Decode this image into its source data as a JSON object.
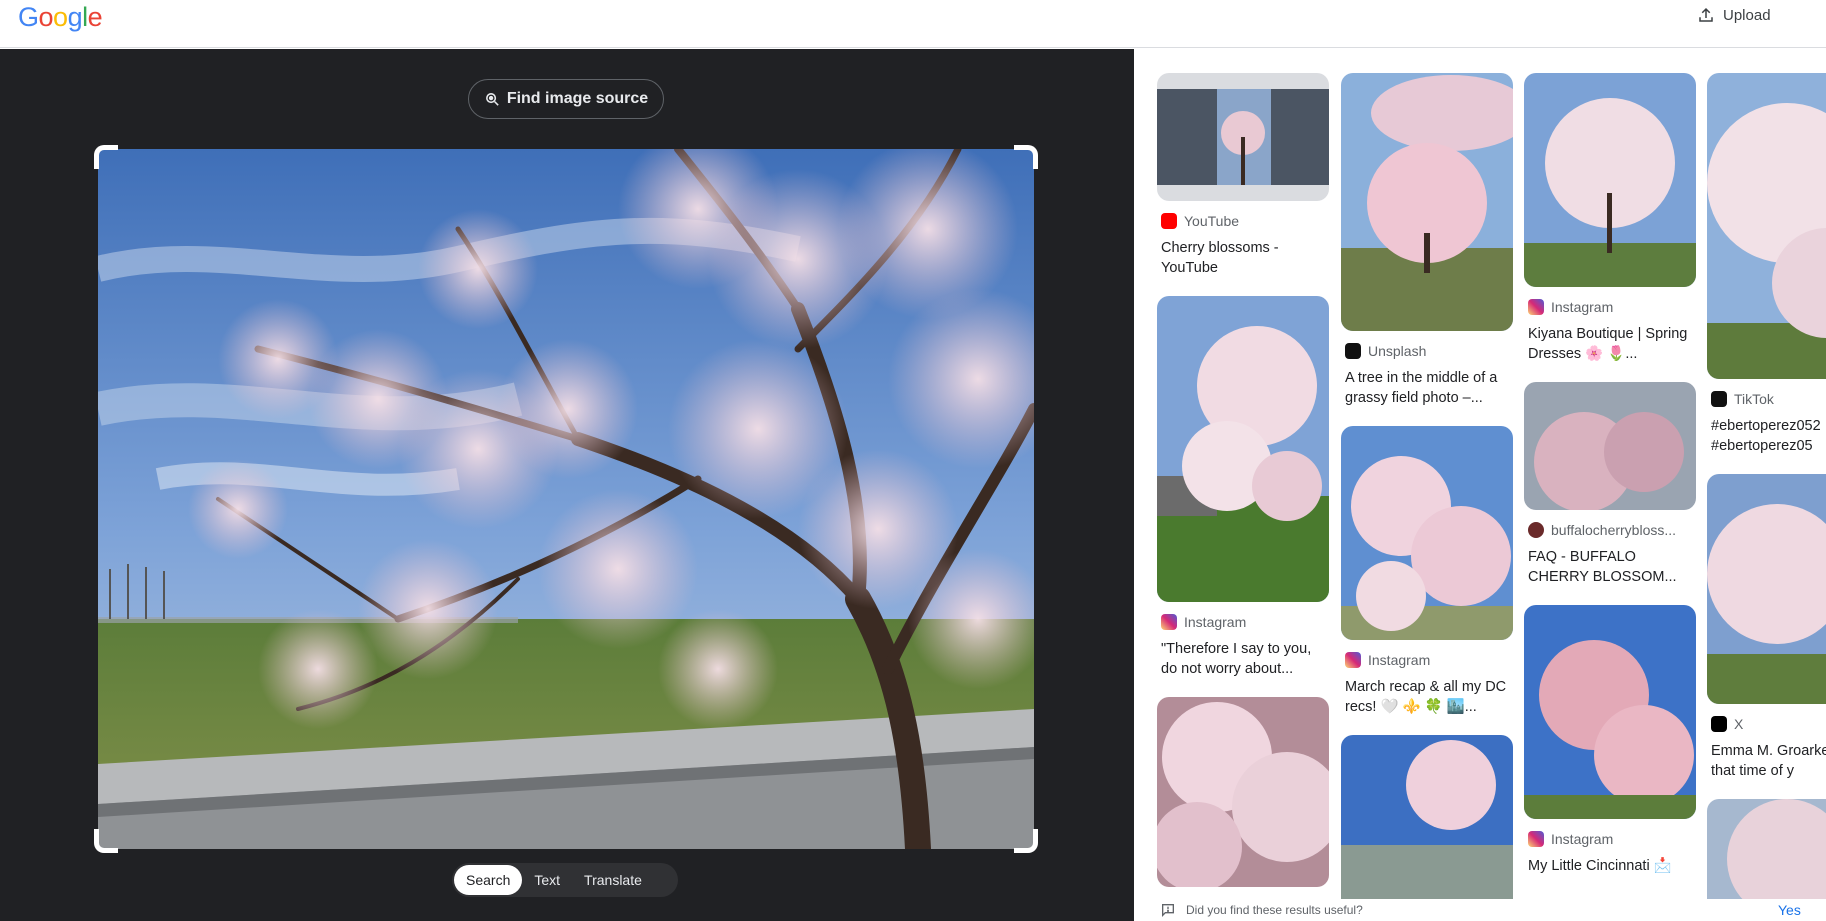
{
  "header": {
    "logo_text": "Google",
    "upload_label": "Upload",
    "upload_icon": "upload-icon"
  },
  "viewer": {
    "find_source_label": "Find image source",
    "find_source_icon": "lens-search-icon",
    "modes": [
      "Search",
      "Text",
      "Translate"
    ],
    "active_mode": "Search"
  },
  "results": {
    "columns": [
      [
        {
          "source": "YouTube",
          "icon": "youtube-icon",
          "title": "Cherry blossoms - YouTube"
        },
        {
          "source": "Instagram",
          "icon": "instagram-icon",
          "title": "\"Therefore I say to you, do not worry about..."
        },
        {
          "source": "",
          "icon": "",
          "title": ""
        }
      ],
      [
        {
          "source": "Unsplash",
          "icon": "unsplash-icon",
          "title": "A tree in the middle of a grassy field photo –..."
        },
        {
          "source": "Instagram",
          "icon": "instagram-icon",
          "title": "March recap & all my DC recs! 🤍 ⚜️ 🍀 🏙️..."
        },
        {
          "source": "",
          "icon": "",
          "title": ""
        }
      ],
      [
        {
          "source": "Instagram",
          "icon": "instagram-icon",
          "title": "Kiyana Boutique | Spring Dresses 🌸 🌷..."
        },
        {
          "source": "buffalocherrybloss...",
          "icon": "buffalo-icon",
          "title": "FAQ - BUFFALO CHERRY BLOSSOM..."
        },
        {
          "source": "Instagram",
          "icon": "instagram-icon",
          "title": "My Little Cincinnati 📩"
        }
      ],
      [
        {
          "source": "TikTok",
          "icon": "tiktok-icon",
          "title": "#ebertoperez052 #ebertoperez05"
        },
        {
          "source": "X",
          "icon": "x-icon",
          "title": "Emma M. Groarke \"It's that time of y"
        },
        {
          "source": "",
          "icon": "",
          "title": ""
        }
      ]
    ]
  },
  "feedback": {
    "question": "Did you find these results useful?",
    "yes_label": "Yes"
  },
  "colors": {
    "viewer_bg": "#202124",
    "accent": "#1a73e8"
  }
}
